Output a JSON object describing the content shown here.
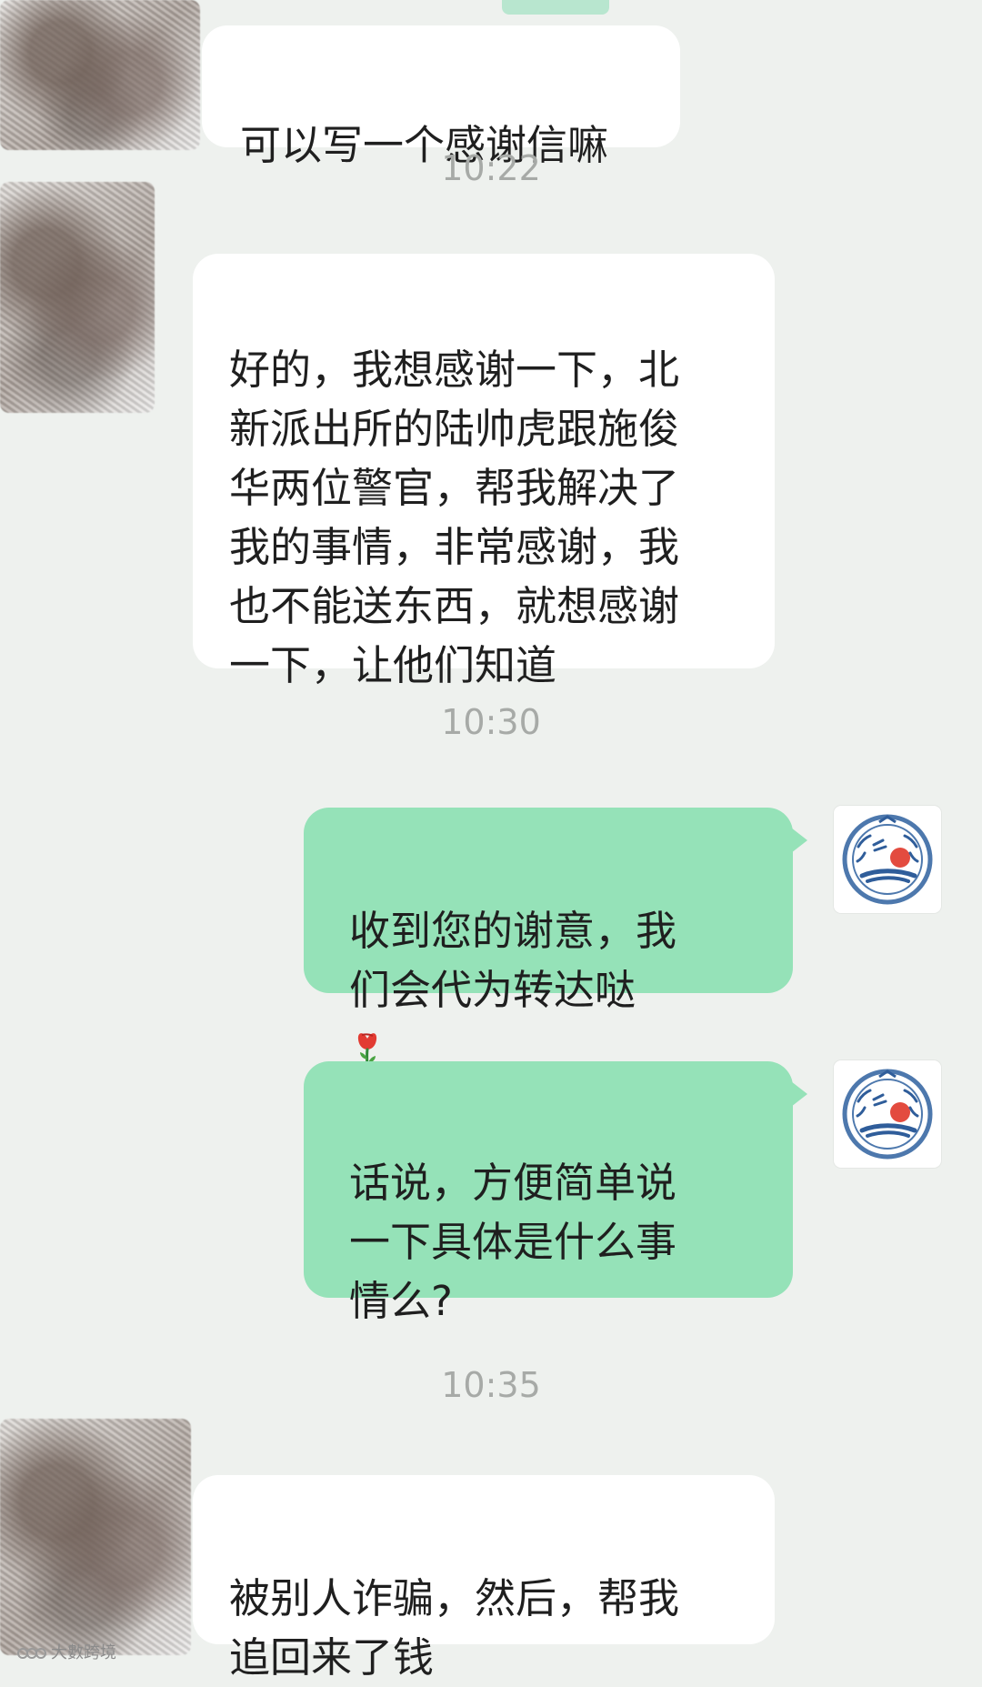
{
  "messages": [
    {
      "side": "incoming",
      "text": "可以写一个感谢信嘛"
    },
    {
      "side": "incoming",
      "text": "好的，我想感谢一下，北\n新派出所的陆帅虎跟施俊\n华两位警官，帮我解决了\n我的事情，非常感谢，我\n也不能送东西，就想感谢\n一下，让他们知道"
    },
    {
      "side": "outgoing",
      "text": "收到您的谢意，我\n们会代为转达哒"
    },
    {
      "side": "outgoing",
      "text": "话说，方便简单说\n一下具体是什么事\n情么?"
    },
    {
      "side": "incoming",
      "text": "被别人诈骗，然后，帮我\n追回来了钱"
    }
  ],
  "timestamps": {
    "t1": "10:22",
    "t2": "10:30",
    "t3": "10:35"
  },
  "icons": {
    "rose": "rose-icon",
    "avatar": "police-badge-avatar",
    "watermark": "watermark-logo"
  },
  "watermark": {
    "text": "大數跨境"
  },
  "colors": {
    "background": "#eef1ee",
    "incoming_bubble": "#ffffff",
    "outgoing_bubble": "#95e2b8",
    "timestamp": "#a7aaa7",
    "text": "#1f1f1f",
    "badge_blue": "#2f5d9a",
    "badge_red": "#e34b3f"
  }
}
